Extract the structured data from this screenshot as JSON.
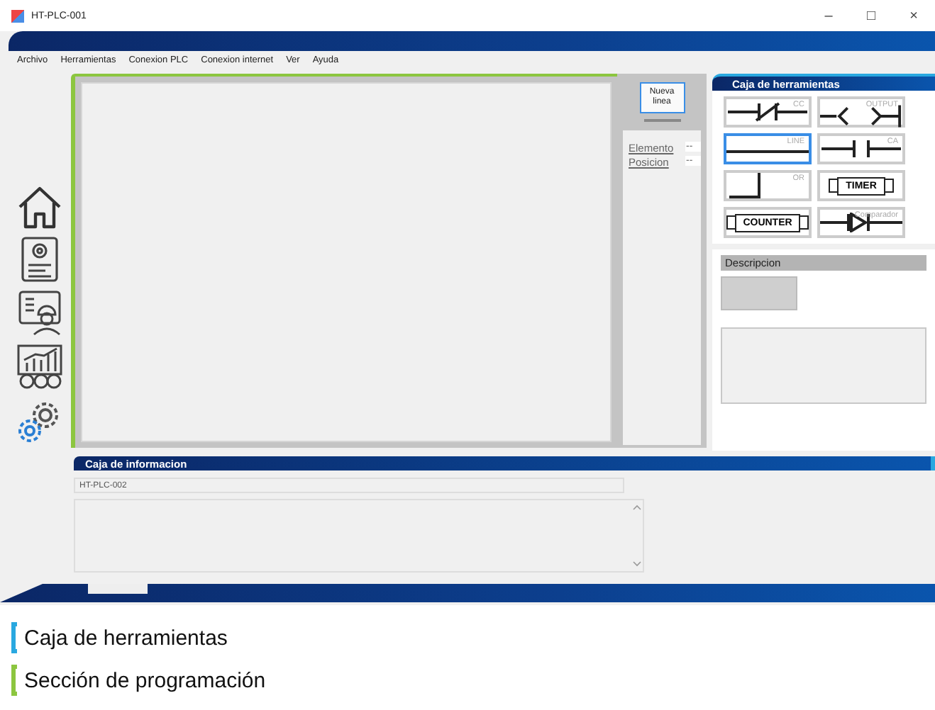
{
  "window": {
    "title": "HT-PLC-001",
    "controls": [
      "–",
      "□",
      "×"
    ]
  },
  "menu": [
    "Archivo",
    "Herramientas",
    "Conexion PLC",
    "Conexion internet",
    "Ver",
    "Ayuda"
  ],
  "sidebar": [
    {
      "kind": "home"
    },
    {
      "kind": "document"
    },
    {
      "kind": "worker"
    },
    {
      "kind": "chart"
    },
    {
      "kind": "gears"
    }
  ],
  "program": {
    "new_line_button": "Nueva linea",
    "properties": [
      {
        "label": "Elemento",
        "value": "--"
      },
      {
        "label": "Posicion",
        "value": "--"
      }
    ]
  },
  "toolbox": {
    "title": "Caja de herramientas",
    "tools": [
      {
        "kind": "cc",
        "label": "CC",
        "selected": false
      },
      {
        "kind": "output",
        "label": "OUTPUT",
        "selected": false
      },
      {
        "kind": "line",
        "label": "LINE",
        "selected": true
      },
      {
        "kind": "ca",
        "label": "CA",
        "selected": false
      },
      {
        "kind": "or",
        "label": "OR",
        "selected": false
      },
      {
        "kind": "timer",
        "text": "TIMER",
        "selected": false
      },
      {
        "kind": "counter",
        "text": "COUNTER",
        "selected": false
      },
      {
        "kind": "comparador",
        "label": "Comparador",
        "selected": false
      }
    ]
  },
  "description": {
    "title": "Descripcion"
  },
  "info_box": {
    "title": "Caja de informacion",
    "field": "HT-PLC-002"
  },
  "legend": [
    {
      "label": "Caja de herramientas",
      "color": "#29a8e0"
    },
    {
      "label": "Sección de programación",
      "color": "#8cc63f"
    }
  ]
}
